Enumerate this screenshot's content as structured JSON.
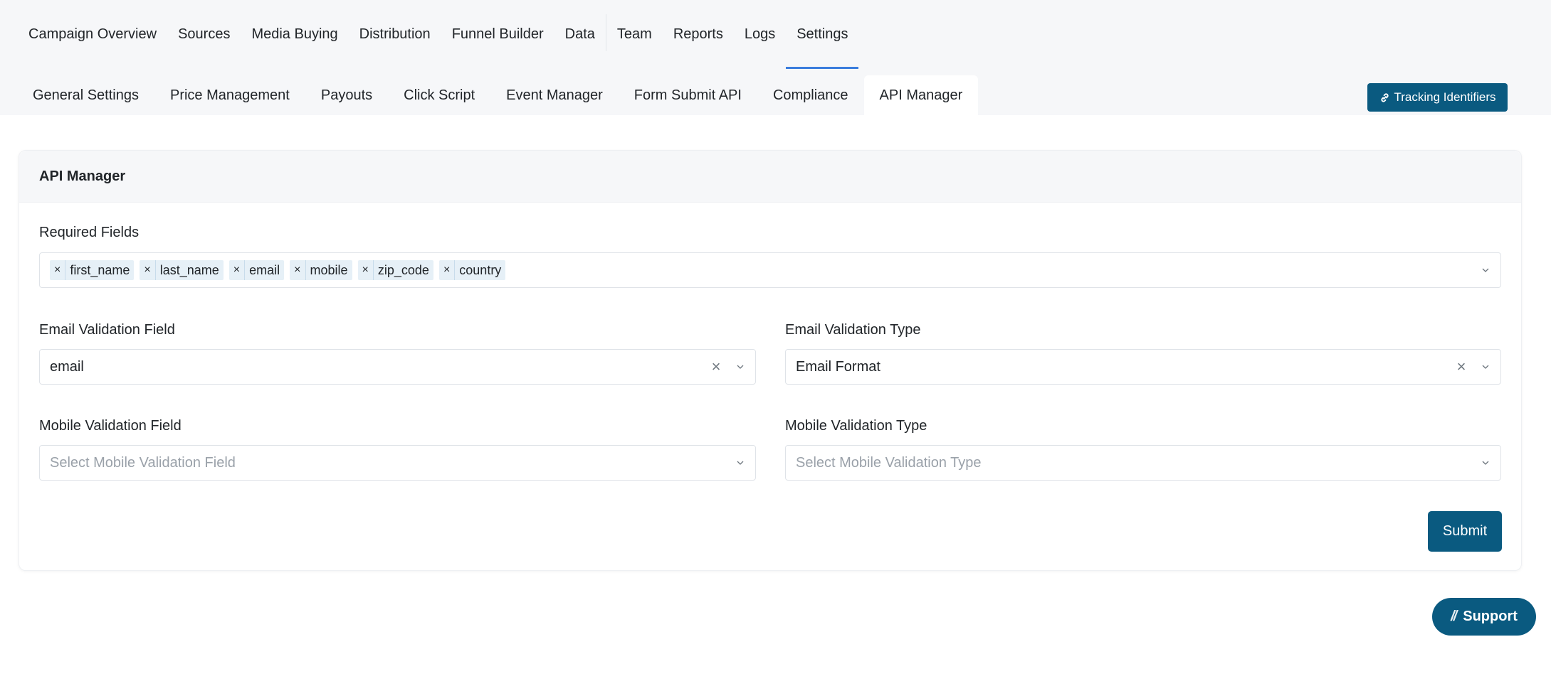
{
  "nav": {
    "items": [
      {
        "label": "Campaign Overview"
      },
      {
        "label": "Sources"
      },
      {
        "label": "Media Buying"
      },
      {
        "label": "Distribution"
      },
      {
        "label": "Funnel Builder"
      },
      {
        "label": "Data"
      },
      {
        "label": "Team"
      },
      {
        "label": "Reports"
      },
      {
        "label": "Logs"
      },
      {
        "label": "Settings"
      }
    ],
    "active": "Settings"
  },
  "tabs": {
    "items": [
      {
        "label": "General Settings"
      },
      {
        "label": "Price Management"
      },
      {
        "label": "Payouts"
      },
      {
        "label": "Click Script"
      },
      {
        "label": "Event Manager"
      },
      {
        "label": "Form Submit API"
      },
      {
        "label": "Compliance"
      },
      {
        "label": "API Manager"
      }
    ],
    "active": "API Manager"
  },
  "tracking_button": {
    "label": "Tracking Identifiers",
    "icon": "link-icon"
  },
  "card": {
    "title": "API Manager",
    "required_fields": {
      "label": "Required Fields",
      "tags": [
        "first_name",
        "last_name",
        "email",
        "mobile",
        "zip_code",
        "country"
      ],
      "remove_glyph": "×"
    },
    "email_validation_field": {
      "label": "Email Validation Field",
      "value": "email"
    },
    "email_validation_type": {
      "label": "Email Validation Type",
      "value": "Email Format"
    },
    "mobile_validation_field": {
      "label": "Mobile Validation Field",
      "placeholder": "Select Mobile Validation Field"
    },
    "mobile_validation_type": {
      "label": "Mobile Validation Type",
      "placeholder": "Select Mobile Validation Type"
    },
    "clear_glyph": "×",
    "submit_label": "Submit"
  },
  "support": {
    "label": "Support",
    "icon_glyph": "//"
  },
  "colors": {
    "accent": "#0a5a80",
    "active_underline": "#3b7ddd",
    "tag_bg": "#e6f0f7",
    "header_bg": "#f6f7f9"
  }
}
